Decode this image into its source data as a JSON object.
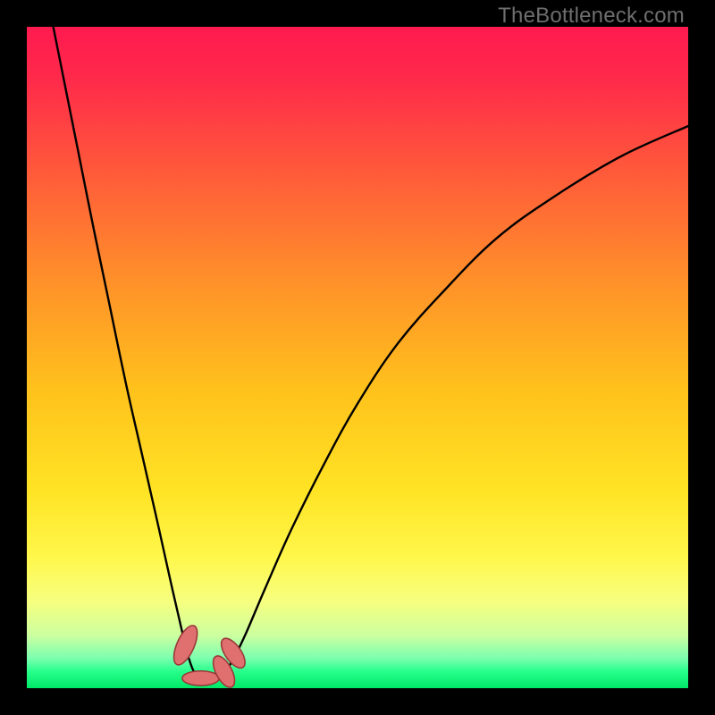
{
  "watermark": "TheBottleneck.com",
  "gradient": {
    "stops": [
      {
        "offset": 0.0,
        "color": "#ff1a4f"
      },
      {
        "offset": 0.08,
        "color": "#ff2a4a"
      },
      {
        "offset": 0.22,
        "color": "#ff5a3a"
      },
      {
        "offset": 0.38,
        "color": "#ff8f2a"
      },
      {
        "offset": 0.55,
        "color": "#ffc21c"
      },
      {
        "offset": 0.7,
        "color": "#ffe324"
      },
      {
        "offset": 0.8,
        "color": "#fff74a"
      },
      {
        "offset": 0.87,
        "color": "#f6ff80"
      },
      {
        "offset": 0.92,
        "color": "#ccffa0"
      },
      {
        "offset": 0.955,
        "color": "#7bffb0"
      },
      {
        "offset": 0.975,
        "color": "#26ff8a"
      },
      {
        "offset": 1.0,
        "color": "#00e868"
      }
    ]
  },
  "chart_data": {
    "type": "line",
    "title": "",
    "xlabel": "",
    "ylabel": "",
    "xlim": [
      0,
      100
    ],
    "ylim": [
      0,
      100
    ],
    "series": [
      {
        "name": "curve",
        "points": [
          {
            "x": 4.0,
            "y": 100.0
          },
          {
            "x": 6.0,
            "y": 90.0
          },
          {
            "x": 8.0,
            "y": 80.0
          },
          {
            "x": 10.0,
            "y": 70.0
          },
          {
            "x": 12.5,
            "y": 58.0
          },
          {
            "x": 15.0,
            "y": 46.0
          },
          {
            "x": 17.5,
            "y": 35.0
          },
          {
            "x": 20.0,
            "y": 24.0
          },
          {
            "x": 22.0,
            "y": 15.0
          },
          {
            "x": 23.5,
            "y": 8.5
          },
          {
            "x": 24.5,
            "y": 4.5
          },
          {
            "x": 25.5,
            "y": 2.0
          },
          {
            "x": 26.5,
            "y": 1.0
          },
          {
            "x": 28.0,
            "y": 1.0
          },
          {
            "x": 29.5,
            "y": 2.0
          },
          {
            "x": 31.0,
            "y": 4.0
          },
          {
            "x": 33.0,
            "y": 8.0
          },
          {
            "x": 36.0,
            "y": 15.0
          },
          {
            "x": 40.0,
            "y": 24.0
          },
          {
            "x": 45.0,
            "y": 34.0
          },
          {
            "x": 50.0,
            "y": 43.0
          },
          {
            "x": 56.0,
            "y": 52.0
          },
          {
            "x": 63.0,
            "y": 60.0
          },
          {
            "x": 71.0,
            "y": 68.0
          },
          {
            "x": 80.0,
            "y": 74.5
          },
          {
            "x": 90.0,
            "y": 80.5
          },
          {
            "x": 100.0,
            "y": 85.0
          }
        ]
      }
    ],
    "markers": [
      {
        "x": 24.0,
        "y": 6.5,
        "rx": 1.3,
        "ry": 3.2,
        "angle": 24
      },
      {
        "x": 26.3,
        "y": 1.5,
        "rx": 2.8,
        "ry": 1.1,
        "angle": 0
      },
      {
        "x": 29.8,
        "y": 2.5,
        "rx": 1.2,
        "ry": 2.6,
        "angle": -28
      },
      {
        "x": 31.2,
        "y": 5.3,
        "rx": 1.2,
        "ry": 2.6,
        "angle": -35
      }
    ],
    "marker_style": {
      "fill": "#e07070",
      "stroke": "#9a3a3a",
      "stroke_width": 1.6
    }
  }
}
